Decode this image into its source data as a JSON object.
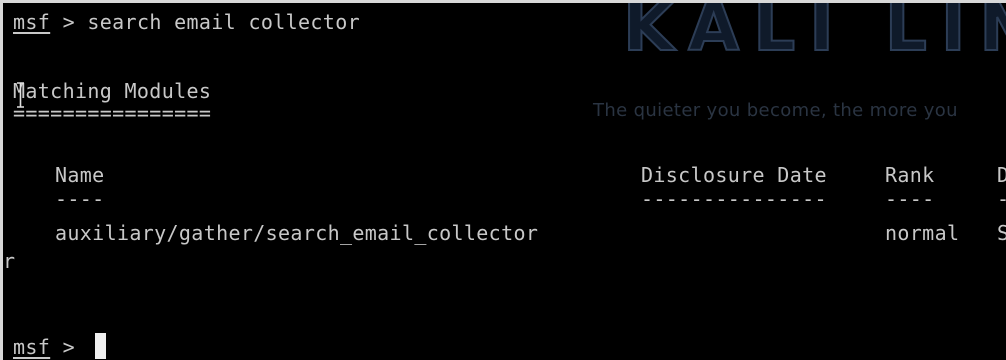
{
  "terminal": {
    "command_line": {
      "prompt": "msf",
      "separator": " > ",
      "command": "search email collector"
    },
    "heading": "Matching Modules",
    "heading_underline": "================",
    "watermark": {
      "logo": "KALI LIN",
      "tagline": "The quieter you become, the more you"
    },
    "table": {
      "headers": {
        "name": "Name",
        "disclosure_date": "Disclosure Date",
        "rank": "Rank",
        "description": "D"
      },
      "separators": {
        "name": "----",
        "disclosure_date": "---------------",
        "rank": "----",
        "description": "-"
      },
      "rows": [
        {
          "name": "auxiliary/gather/search_email_collector",
          "disclosure_date": "",
          "rank": "normal",
          "description": "S",
          "wrap": "r"
        }
      ]
    },
    "final_prompt": {
      "prompt": "msf",
      "separator": " > "
    }
  },
  "colors": {
    "background": "#000000",
    "text": "#c8c8c8",
    "cursor": "#f0f0f0"
  }
}
